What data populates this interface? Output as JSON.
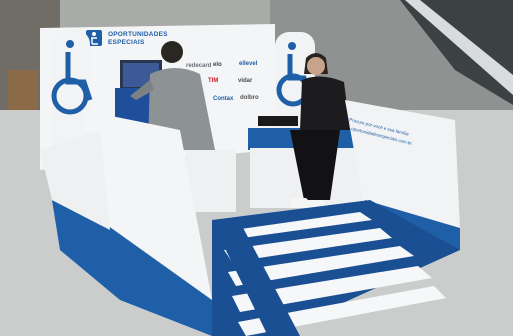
{
  "booth_panel": {
    "brand_line1": "OPORTUNIDADES",
    "brand_line2": "ESPECIAIS",
    "sponsors": [
      "redecard",
      "elo",
      "ellevel",
      "TIM",
      "vidar",
      "Contax",
      "dolbro"
    ]
  },
  "side_panel_text": [
    "Procure por você e sua família",
    "oportunidadesespeciais.com.br"
  ],
  "icons": [
    "wheelchair-icon",
    "wheelchair-icon",
    "wheelchair-icon"
  ],
  "colors": {
    "booth_white": "#f2f3f4",
    "accent_blue": "#1f5fa8",
    "floor": "#cbcdcc",
    "ramp_stripe": "#1a4f94"
  }
}
